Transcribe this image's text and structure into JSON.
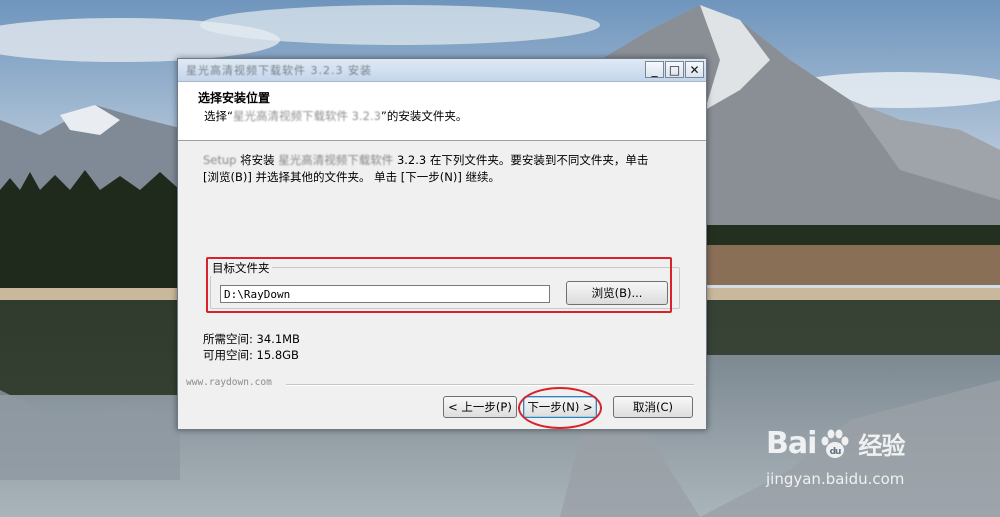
{
  "window": {
    "title": "星光高清视频下载软件 3.2.3 安装",
    "controls": {
      "minimize": "_",
      "maximize": "□",
      "close": "✕"
    }
  },
  "header": {
    "title": "选择安装位置",
    "subtitle_prefix": "选择“",
    "subtitle_app": "星光高清视频下载软件 3.2.3",
    "subtitle_suffix": "”的安装文件夹。"
  },
  "description": {
    "line1_prefix": "Setup",
    "line1_mid": " 将安装 ",
    "line1_app": "星光高清视频下载软件",
    "line1_rest": " 3.2.3 在下列文件夹。要安装到不同文件夹，单击",
    "line2": "[浏览(B)] 并选择其他的文件夹。 单击 [下一步(N)] 继续。"
  },
  "destination": {
    "group_label": "目标文件夹",
    "path": "D:\\RayDown",
    "browse_label": "浏览(B)..."
  },
  "space": {
    "required": "所需空间: 34.1MB",
    "available": "可用空间: 15.8GB"
  },
  "branding": "www.raydown.com",
  "buttons": {
    "back": "< 上一步(P)",
    "next": "下一步(N) >",
    "cancel": "取消(C)"
  },
  "watermark": {
    "logo_left": "Bai",
    "logo_right": "du",
    "logo_cn": "经验",
    "url": "jingyan.baidu.com"
  },
  "colors": {
    "annotation_red": "#d8232a",
    "window_bg": "#f0f0f0",
    "header_bg": "#ffffff"
  }
}
